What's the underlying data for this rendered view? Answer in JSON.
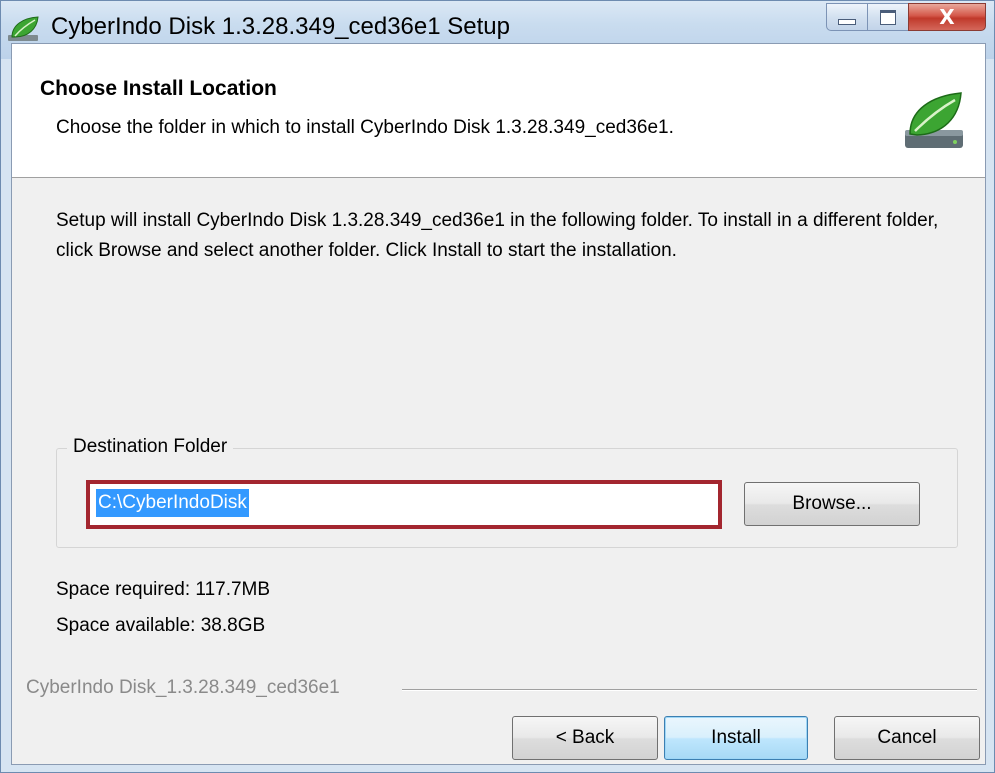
{
  "window": {
    "title": "CyberIndo Disk 1.3.28.349_ced36e1 Setup",
    "icon": "leaf-icon",
    "controls": {
      "minimize_icon": "minimize-icon",
      "maximize_icon": "maximize-icon",
      "close_label": "X"
    }
  },
  "header": {
    "title": "Choose Install Location",
    "subtitle": "Choose the folder in which to install CyberIndo Disk 1.3.28.349_ced36e1.",
    "logo": "leaf-icon"
  },
  "body": {
    "intro": "Setup will install CyberIndo Disk 1.3.28.349_ced36e1 in the following folder. To install in a different folder, click Browse and select another folder. Click Install to start the installation.",
    "destination": {
      "group_label": "Destination Folder",
      "value": "C:\\CyberIndoDisk",
      "browse_label": "Browse..."
    },
    "space_required": "Space required: 117.7MB",
    "space_available": "Space available: 38.8GB"
  },
  "footer": {
    "branding": "CyberIndo Disk_1.3.28.349_ced36e1",
    "back_label": "< Back",
    "install_label": "Install",
    "cancel_label": "Cancel"
  },
  "colors": {
    "highlight_outline": "#a3262f",
    "selection": "#3399ff",
    "leaf_green": "#3ca532"
  }
}
